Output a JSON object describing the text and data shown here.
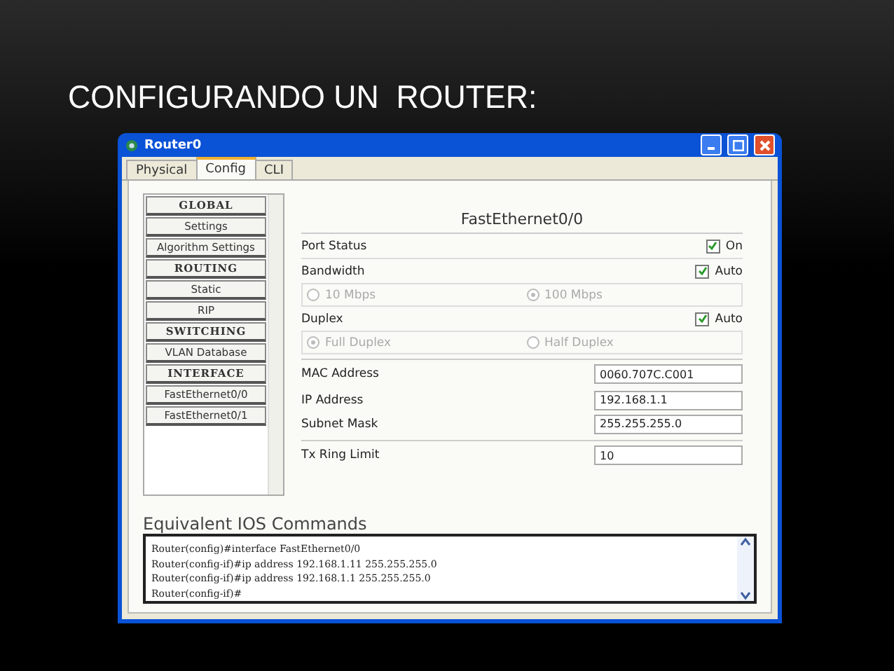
{
  "slide_title": "CONFIGURANDO UN  ROUTER:",
  "window": {
    "title": "Router0"
  },
  "tabs": [
    {
      "label": "Physical",
      "selected": false
    },
    {
      "label": "Config",
      "selected": true
    },
    {
      "label": "CLI",
      "selected": false
    }
  ],
  "sidebar": {
    "items": [
      {
        "label": "GLOBAL",
        "kind": "header"
      },
      {
        "label": "Settings",
        "kind": "item"
      },
      {
        "label": "Algorithm Settings",
        "kind": "item"
      },
      {
        "label": "ROUTING",
        "kind": "header"
      },
      {
        "label": "Static",
        "kind": "item"
      },
      {
        "label": "RIP",
        "kind": "item"
      },
      {
        "label": "SWITCHING",
        "kind": "header"
      },
      {
        "label": "VLAN Database",
        "kind": "item"
      },
      {
        "label": "INTERFACE",
        "kind": "header"
      },
      {
        "label": "FastEthernet0/0",
        "kind": "item"
      },
      {
        "label": "FastEthernet0/1",
        "kind": "item"
      }
    ]
  },
  "interface": {
    "title": "FastEthernet0/0",
    "rows": [
      {
        "kind": "check",
        "label": "Port Status",
        "option": "On",
        "checked": true
      },
      {
        "kind": "check",
        "label": "Bandwidth",
        "option": "Auto",
        "checked": true
      },
      {
        "kind": "radio",
        "disabled": true,
        "options": [
          {
            "label": "10 Mbps",
            "selected": false
          },
          {
            "label": "100 Mbps",
            "selected": true
          }
        ]
      },
      {
        "kind": "check",
        "label": "Duplex",
        "option": "Auto",
        "checked": true
      },
      {
        "kind": "radio",
        "disabled": true,
        "options": [
          {
            "label": "Full Duplex",
            "selected": true
          },
          {
            "label": "Half Duplex",
            "selected": false
          }
        ]
      },
      {
        "kind": "field",
        "label": "MAC Address",
        "value": "0060.707C.C001"
      },
      {
        "kind": "field",
        "label": "IP Address",
        "value": "192.168.1.1"
      },
      {
        "kind": "field",
        "label": "Subnet Mask",
        "value": "255.255.255.0"
      },
      {
        "kind": "field",
        "label": "Tx Ring Limit",
        "value": "10"
      }
    ]
  },
  "console": {
    "title": "Equivalent IOS Commands",
    "lines": [
      "Router(config)#interface FastEthernet0/0",
      "Router(config-if)#ip address 192.168.1.11 255.255.255.0",
      "Router(config-if)#ip address 192.168.1.1 255.255.255.0",
      "Router(config-if)#"
    ]
  }
}
